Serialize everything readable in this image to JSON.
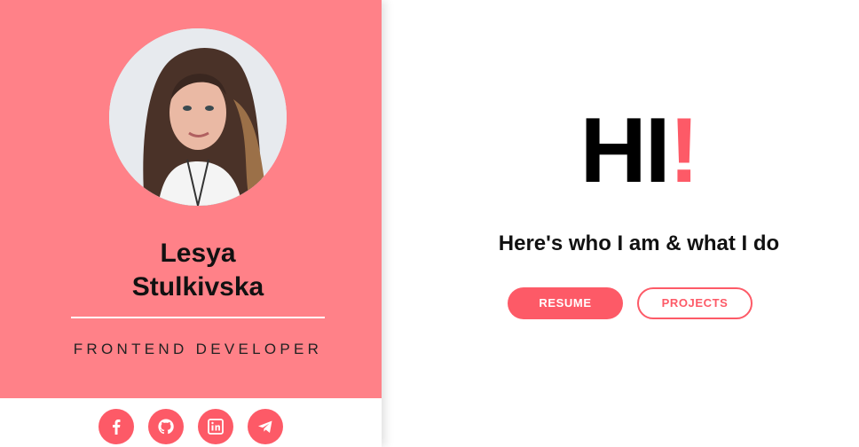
{
  "profile": {
    "first_name": "Lesya",
    "last_name": "Stulkivska",
    "role": "FRONTEND DEVELOPER",
    "avatar_alt": "profile-photo"
  },
  "socials": [
    {
      "name": "facebook-icon"
    },
    {
      "name": "github-icon"
    },
    {
      "name": "linkedin-icon"
    },
    {
      "name": "telegram-icon"
    }
  ],
  "hero": {
    "greeting": "HI",
    "exclamation": "!",
    "tagline": "Here's who I am & what I do",
    "resume_label": "RESUME",
    "projects_label": "PROJECTS"
  },
  "colors": {
    "card_background": "#ff8188",
    "accent": "#fd5a67",
    "text": "#111111"
  }
}
